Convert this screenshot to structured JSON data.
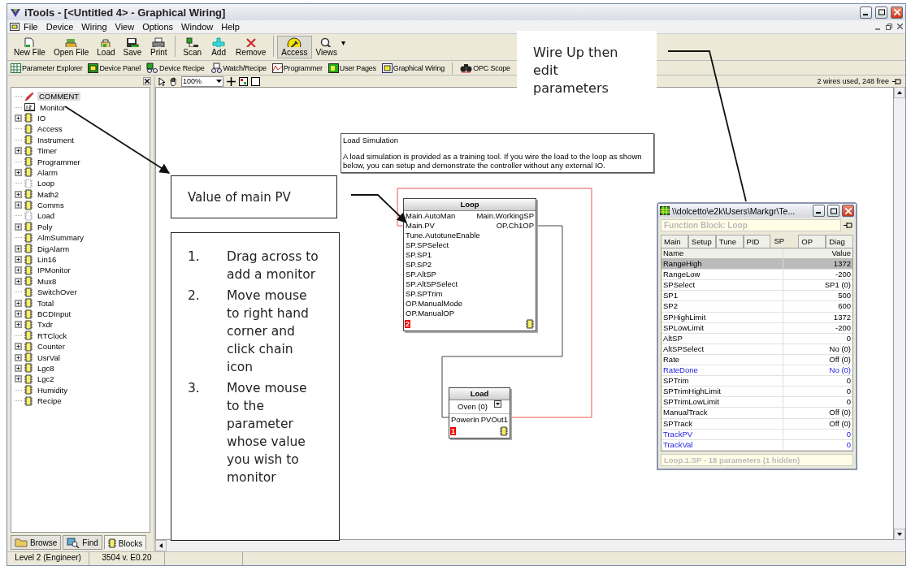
{
  "window": {
    "title": "iTools - [<Untitled 4> - Graphical Wiring]"
  },
  "menu": [
    "File",
    "Device",
    "Wiring",
    "View",
    "Options",
    "Window",
    "Help"
  ],
  "toolbar": [
    {
      "label": "New File",
      "selected": false
    },
    {
      "label": "Open File",
      "selected": false
    },
    {
      "label": "Load",
      "selected": false
    },
    {
      "label": "Save",
      "selected": false
    },
    {
      "label": "Print",
      "selected": false
    },
    {
      "label": "Scan",
      "selected": false
    },
    {
      "label": "Add",
      "selected": false
    },
    {
      "label": "Remove",
      "selected": false
    },
    {
      "label": "Access",
      "selected": true
    },
    {
      "label": "Views",
      "selected": false
    }
  ],
  "views_toggle": "▾",
  "toolbar2": [
    "Parameter Explorer",
    "Device Panel",
    "Device Recipe",
    "Watch/Recipe",
    "Programmer",
    "User Pages",
    "Graphical Wiring",
    "OPC Scope"
  ],
  "tree": [
    {
      "label": "COMMENT",
      "kind": "comment",
      "expandable": false,
      "selected": true
    },
    {
      "label": "Monitor",
      "kind": "monitor",
      "expandable": false,
      "selected": false
    },
    {
      "label": "IO",
      "kind": "block",
      "expandable": true,
      "selected": false
    },
    {
      "label": "Access",
      "kind": "block",
      "expandable": false,
      "selected": false
    },
    {
      "label": "Instrument",
      "kind": "block",
      "expandable": false,
      "selected": false
    },
    {
      "label": "Timer",
      "kind": "block",
      "expandable": true,
      "selected": false
    },
    {
      "label": "Programmer",
      "kind": "block",
      "expandable": false,
      "selected": false
    },
    {
      "label": "Alarm",
      "kind": "block",
      "expandable": true,
      "selected": false
    },
    {
      "label": "Loop",
      "kind": "placed",
      "expandable": false,
      "selected": false
    },
    {
      "label": "Math2",
      "kind": "block",
      "expandable": true,
      "selected": false
    },
    {
      "label": "Comms",
      "kind": "block",
      "expandable": true,
      "selected": false
    },
    {
      "label": "Load",
      "kind": "placed",
      "expandable": false,
      "selected": false
    },
    {
      "label": "Poly",
      "kind": "block",
      "expandable": true,
      "selected": false
    },
    {
      "label": "AlmSummary",
      "kind": "block",
      "expandable": false,
      "selected": false
    },
    {
      "label": "DigAlarm",
      "kind": "block",
      "expandable": true,
      "selected": false
    },
    {
      "label": "Lin16",
      "kind": "block",
      "expandable": true,
      "selected": false
    },
    {
      "label": "IPMonitor",
      "kind": "block",
      "expandable": true,
      "selected": false
    },
    {
      "label": "Mux8",
      "kind": "block",
      "expandable": true,
      "selected": false
    },
    {
      "label": "SwitchOver",
      "kind": "block",
      "expandable": false,
      "selected": false
    },
    {
      "label": "Total",
      "kind": "block",
      "expandable": true,
      "selected": false
    },
    {
      "label": "BCDInput",
      "kind": "block",
      "expandable": true,
      "selected": false
    },
    {
      "label": "Txdr",
      "kind": "block",
      "expandable": true,
      "selected": false
    },
    {
      "label": "RTClock",
      "kind": "block",
      "expandable": false,
      "selected": false
    },
    {
      "label": "Counter",
      "kind": "block",
      "expandable": true,
      "selected": false
    },
    {
      "label": "UsrVal",
      "kind": "block",
      "expandable": true,
      "selected": false
    },
    {
      "label": "Lgc8",
      "kind": "block",
      "expandable": true,
      "selected": false
    },
    {
      "label": "Lgc2",
      "kind": "block",
      "expandable": true,
      "selected": false
    },
    {
      "label": "Humidity",
      "kind": "block",
      "expandable": false,
      "selected": false
    },
    {
      "label": "Recipe",
      "kind": "block",
      "expandable": false,
      "selected": false
    }
  ],
  "panel_tabs": [
    {
      "label": "Browse",
      "selected": false
    },
    {
      "label": "Find",
      "selected": false
    },
    {
      "label": "Blocks",
      "selected": true
    }
  ],
  "canvas_toolbar": {
    "zoom": "100%",
    "wires_info": "2 wires used, 248 free"
  },
  "comment": {
    "title": "Load Simulation",
    "text": "A load simulation is provided as a training tool. If you wire the load to the loop as shown below, you can setup and demonstrate the controller without any external IO."
  },
  "loop_block": {
    "title": "Loop",
    "inputs": [
      "Main.AutoMan",
      "Main.PV",
      "Tune.AutotuneEnable",
      "SP.SPSelect",
      "SP.SP1",
      "SP.SP2",
      "SP.AltSP",
      "SP.AltSPSelect",
      "SP.SPTrim",
      "OP.ManualMode",
      "OP.ManualOP"
    ],
    "outputs": [
      "Main.WorkingSP",
      "OP.Ch1OP"
    ],
    "order": "2"
  },
  "load_block": {
    "title": "Load",
    "type": "Oven (0)",
    "input": "PowerIn",
    "output": "PVOut1",
    "order": "1"
  },
  "param_window": {
    "title": "\\\\dolcetto\\e2k\\Users\\Markgr\\Te...",
    "function_block": "Function Block:  Loop",
    "tabs": [
      {
        "label": "Main",
        "selected": false
      },
      {
        "label": "Setup",
        "selected": false
      },
      {
        "label": "Tune",
        "selected": false
      },
      {
        "label": "PID",
        "selected": false
      },
      {
        "label": "SP",
        "selected": true
      },
      {
        "label": "OP",
        "selected": false
      },
      {
        "label": "Diag",
        "selected": false
      }
    ],
    "columns": [
      "Name",
      "Value"
    ],
    "rows": [
      {
        "name": "RangeHigh",
        "value": "1372",
        "readonly": false,
        "selected": true
      },
      {
        "name": "RangeLow",
        "value": "-200",
        "readonly": false,
        "selected": false
      },
      {
        "name": "SPSelect",
        "value": "SP1 (0)",
        "readonly": false,
        "selected": false
      },
      {
        "name": "SP1",
        "value": "500",
        "readonly": false,
        "selected": false
      },
      {
        "name": "SP2",
        "value": "600",
        "readonly": false,
        "selected": false
      },
      {
        "name": "SPHighLimit",
        "value": "1372",
        "readonly": false,
        "selected": false
      },
      {
        "name": "SPLowLimit",
        "value": "-200",
        "readonly": false,
        "selected": false
      },
      {
        "name": "AltSP",
        "value": "0",
        "readonly": false,
        "selected": false
      },
      {
        "name": "AltSPSelect",
        "value": "No (0)",
        "readonly": false,
        "selected": false
      },
      {
        "name": "Rate",
        "value": "Off (0)",
        "readonly": false,
        "selected": false
      },
      {
        "name": "RateDone",
        "value": "No (0)",
        "readonly": true,
        "selected": false
      },
      {
        "name": "SPTrim",
        "value": "0",
        "readonly": false,
        "selected": false
      },
      {
        "name": "SPTrimHighLimit",
        "value": "0",
        "readonly": false,
        "selected": false
      },
      {
        "name": "SPTrimLowLimit",
        "value": "0",
        "readonly": false,
        "selected": false
      },
      {
        "name": "ManualTrack",
        "value": "Off (0)",
        "readonly": false,
        "selected": false
      },
      {
        "name": "SPTrack",
        "value": "Off (0)",
        "readonly": false,
        "selected": false
      },
      {
        "name": "TrackPV",
        "value": "0",
        "readonly": true,
        "selected": false
      },
      {
        "name": "TrackVal",
        "value": "0",
        "readonly": true,
        "selected": false
      }
    ],
    "footer": "Loop.1.SP  -  18 parameters (1 hidden)"
  },
  "status_bar": [
    "Level 2 (Engineer)",
    "3504 v. E0.20"
  ],
  "callouts": {
    "pv": "Value of main PV",
    "wire_up": "Wire Up then edit parameters",
    "steps": [
      {
        "number": "1.",
        "text": "Drag across to add a monitor"
      },
      {
        "number": "2.",
        "text": "Move mouse to right hand corner and click chain icon"
      },
      {
        "number": "3.",
        "text": "Move mouse to the parameter whose value you wish to monitor"
      }
    ]
  }
}
